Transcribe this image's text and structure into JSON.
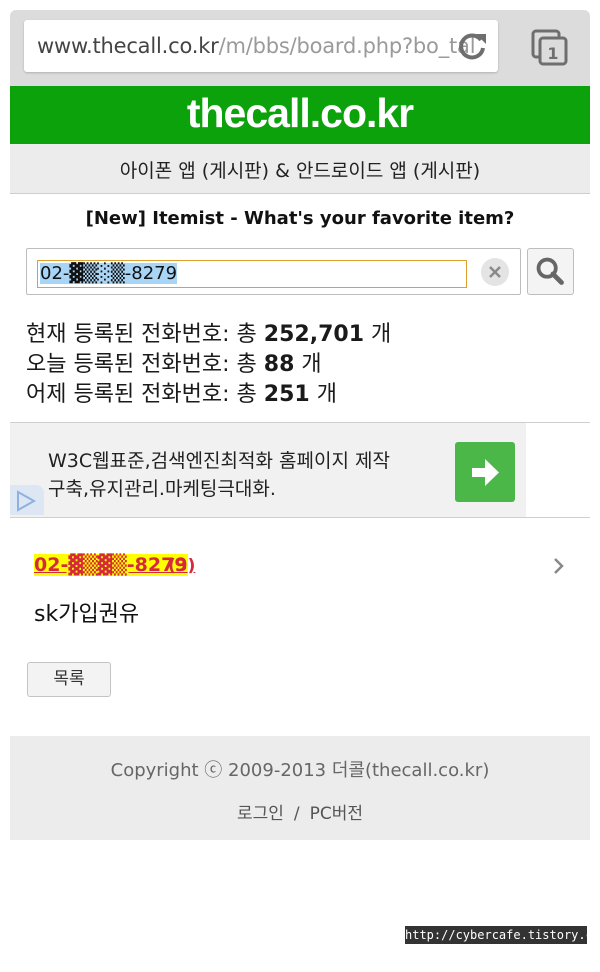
{
  "browser": {
    "url_host": "www.thecall.co.kr",
    "url_path": "/m/bbs/board.php?bo_tal",
    "tab_count": "1"
  },
  "header": {
    "logo_text": "thecall.co.kr",
    "color": "#0ba20b"
  },
  "subnav": {
    "text": "아이폰 앱 (게시판) & 안드로이드 앱 (게시판)"
  },
  "notice": {
    "text": "[New] Itemist - What's your favorite item?"
  },
  "search": {
    "value": "02-▓▒░▒-8279"
  },
  "stats": {
    "total_prefix": "현재 등록된 전화번호: 총",
    "total_value": "252,701",
    "today_prefix": "오늘 등록된 전화번호: 총",
    "today_value": "88",
    "yesterday_prefix": "어제 등록된 전화번호: 총",
    "yesterday_value": "251",
    "unit": "개"
  },
  "ad": {
    "line1": "W3C웹표준,검색엔진최적화 홈페이지 제작",
    "line2": "구축,유지관리.마케팅극대화.",
    "button_color": "#4cb749"
  },
  "entry": {
    "number": "02-▓▒▓▒-8279",
    "count": "(3)",
    "title": "sk가입권유"
  },
  "list_button": "목록",
  "footer": {
    "copyright": "Copyright ⓒ 2009-2013 더콜(thecall.co.kr)",
    "login": "로그인",
    "separator": "/",
    "pc_version": "PC버전"
  },
  "watermark": "http://cybercafe.tistory.com"
}
